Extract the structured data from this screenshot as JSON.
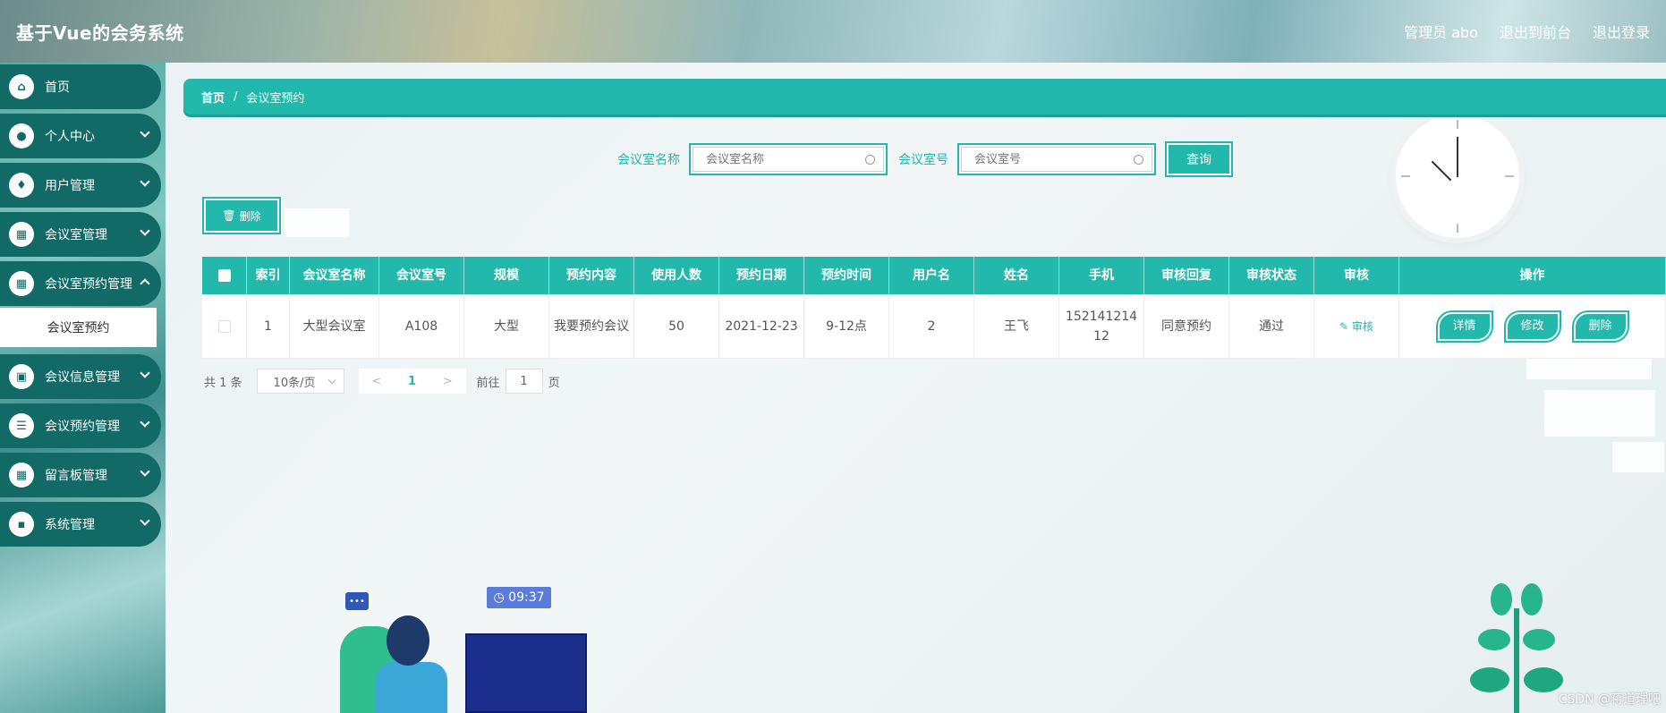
{
  "header": {
    "app_title": "基于Vue的会务系统",
    "admin_label": "管理员 abo",
    "exit_front": "退出到前台",
    "logout": "退出登录"
  },
  "sidebar": {
    "items": [
      {
        "label": "首页",
        "icon": "home-icon",
        "glyph": "⌂"
      },
      {
        "label": "个人中心",
        "icon": "user-icon",
        "glyph": "●"
      },
      {
        "label": "用户管理",
        "icon": "location-icon",
        "glyph": "♦"
      },
      {
        "label": "会议室管理",
        "icon": "grid-icon",
        "glyph": "▦"
      },
      {
        "label": "会议室预约管理",
        "icon": "apps-icon",
        "glyph": "▦"
      },
      {
        "label": "会议信息管理",
        "icon": "clipboard-icon",
        "glyph": "▣"
      },
      {
        "label": "会议预约管理",
        "icon": "list-icon",
        "glyph": "☰"
      },
      {
        "label": "留言板管理",
        "icon": "grid-icon",
        "glyph": "▦"
      },
      {
        "label": "系统管理",
        "icon": "briefcase-icon",
        "glyph": "▪"
      }
    ],
    "submenu_active": "会议室预约"
  },
  "breadcrumb": {
    "home": "首页",
    "separator": "/",
    "current": "会议室预约"
  },
  "search": {
    "room_name_label": "会议室名称",
    "room_name_placeholder": "会议室名称",
    "room_no_label": "会议室号",
    "room_no_placeholder": "会议室号",
    "query_button": "查询"
  },
  "toolbar": {
    "delete_button": "删除"
  },
  "table": {
    "columns": [
      "索引",
      "会议室名称",
      "会议室号",
      "规模",
      "预约内容",
      "使用人数",
      "预约日期",
      "预约时间",
      "用户名",
      "姓名",
      "手机",
      "审核回复",
      "审核状态",
      "审核",
      "操作"
    ],
    "rows": [
      {
        "index": "1",
        "room_name": "大型会议室",
        "room_no": "A108",
        "scale": "大型",
        "content": "我要预约会议",
        "people": "50",
        "date": "2021-12-23",
        "time": "9-12点",
        "username": "2",
        "name": "王飞",
        "phone": "15214121412",
        "reply": "同意预约",
        "status": "通过",
        "audit": "审核",
        "actions": {
          "detail": "详情",
          "edit": "修改",
          "delete": "删除"
        }
      }
    ]
  },
  "pagination": {
    "total": "共 1 条",
    "page_size": "10条/页",
    "current_page": "1",
    "goto_prefix": "前往",
    "goto_value": "1",
    "goto_suffix": "页"
  },
  "decor": {
    "time_badge": "09:37",
    "chat_dots": "•••"
  },
  "watermark": "CSDN @蒋道理吧",
  "colors": {
    "accent": "#23b8ac",
    "sidebar_item": "#126a66"
  }
}
